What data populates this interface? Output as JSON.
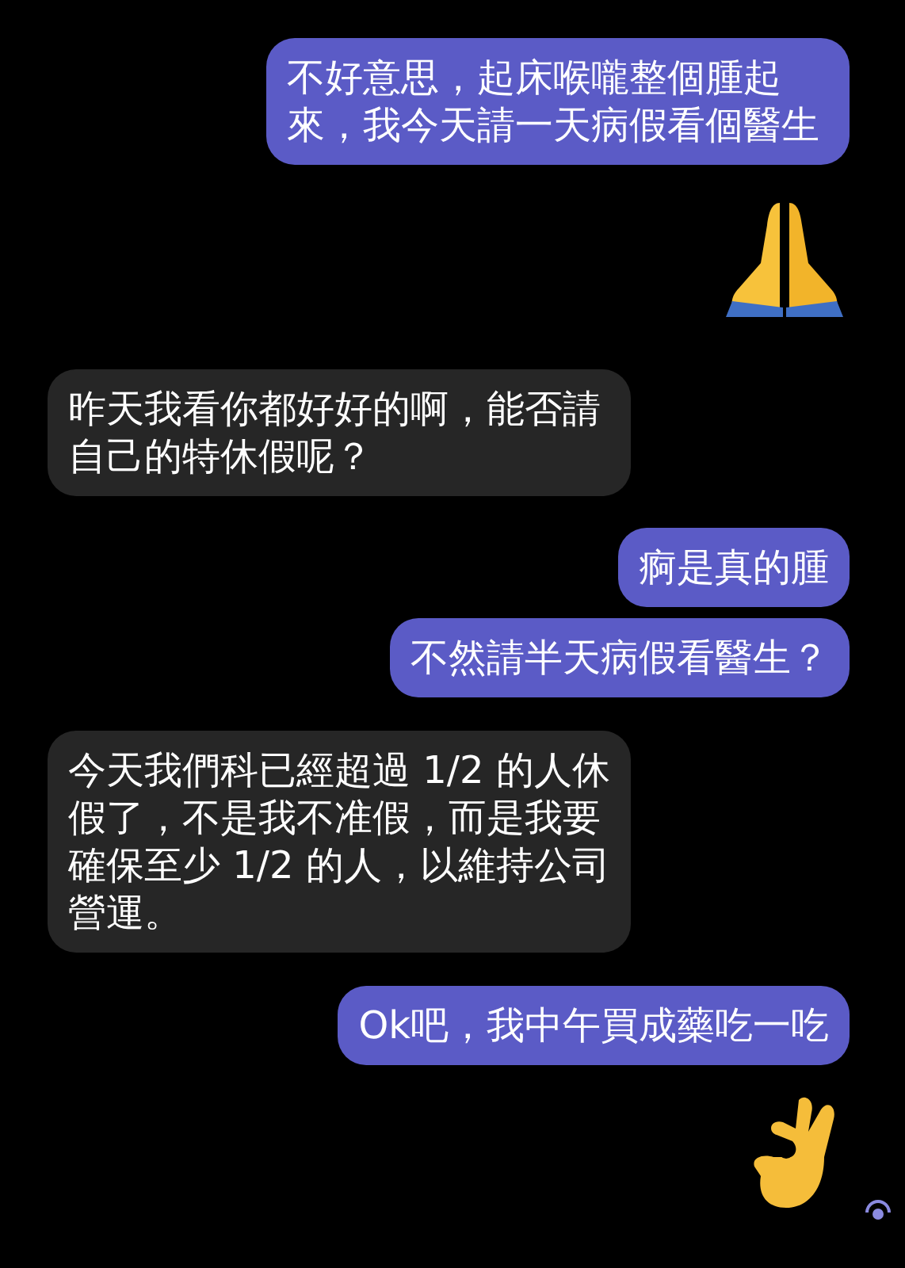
{
  "messages": [
    {
      "kind": "sent",
      "text": "不好意思，起床喉嚨整個腫起來，我今天請一天病假看個醫生"
    },
    {
      "kind": "pray"
    },
    {
      "kind": "received",
      "text": "昨天我看你都好好的啊，能否請自己的特休假呢？"
    },
    {
      "kind": "sent",
      "text": "痾是真的腫"
    },
    {
      "kind": "sent",
      "text": "不然請半天病假看醫生？"
    },
    {
      "kind": "received",
      "text": "今天我們科已經超過 1/2 的人休假了，不是我不准假，而是我要確保至少 1/2 的人，以維持公司營運。"
    },
    {
      "kind": "sent",
      "text": "Ok吧，我中午買成藥吃一吃"
    },
    {
      "kind": "okhand"
    }
  ]
}
